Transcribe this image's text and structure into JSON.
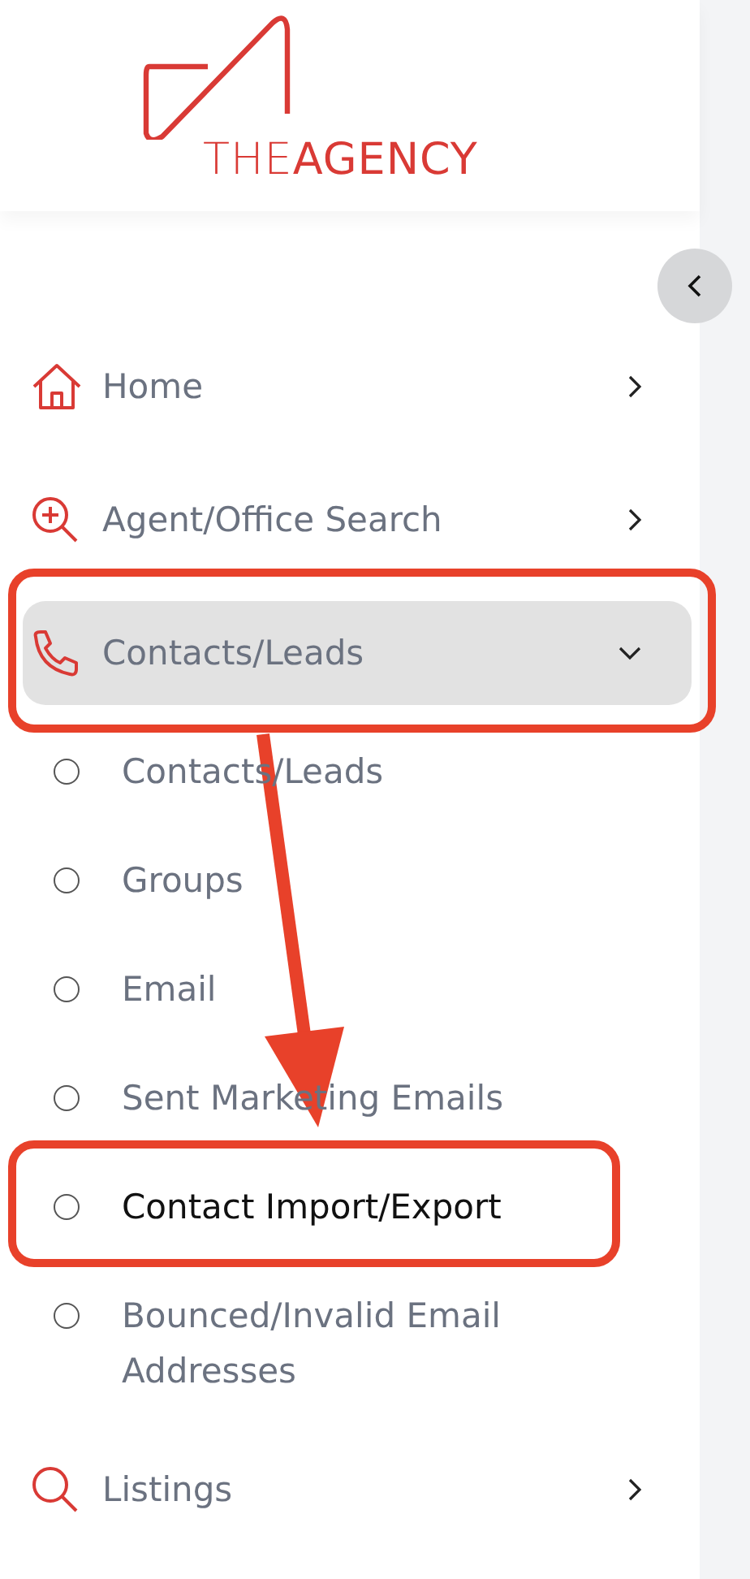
{
  "logo": {
    "text": "THE**AGENCY**"
  },
  "menu": [
    {
      "label": "Home",
      "kind": "home",
      "expanded": false,
      "highlighted": false
    },
    {
      "label": "Agent/Office Search",
      "kind": "search-plus",
      "expanded": false,
      "highlighted": false
    },
    {
      "label": "Contacts/Leads",
      "kind": "phone",
      "expanded": true,
      "highlighted": true,
      "children": [
        {
          "label": "Contacts/Leads",
          "selected": false,
          "highlighted": false
        },
        {
          "label": "Groups",
          "selected": false,
          "highlighted": false
        },
        {
          "label": "Email",
          "selected": false,
          "highlighted": false
        },
        {
          "label": "Sent Marketing Emails",
          "selected": false,
          "highlighted": false
        },
        {
          "label": "Contact Import/Export",
          "selected": true,
          "highlighted": true
        },
        {
          "label": "Bounced/Invalid Email Addresses",
          "selected": false,
          "highlighted": false
        }
      ]
    },
    {
      "label": "Listings",
      "kind": "search",
      "expanded": false,
      "highlighted": false
    }
  ]
}
